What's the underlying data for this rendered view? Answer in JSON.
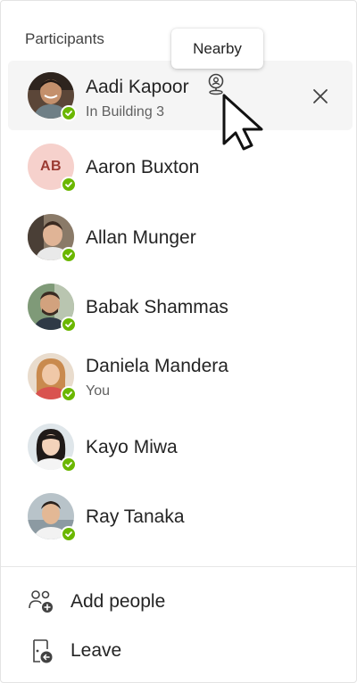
{
  "panel": {
    "section_title": "Participants",
    "tooltip": "Nearby"
  },
  "participants": [
    {
      "name": "Aadi Kapoor",
      "sub": "In Building 3",
      "avatar": "photo",
      "presence": "available",
      "selected": true,
      "nearby_icon": "location-person-icon",
      "remove_icon": "close-icon"
    },
    {
      "name": "Aaron Buxton",
      "sub": "",
      "avatar": "initials",
      "initials": "AB",
      "presence": "available"
    },
    {
      "name": "Allan Munger",
      "sub": "",
      "avatar": "photo",
      "presence": "available"
    },
    {
      "name": "Babak Shammas",
      "sub": "",
      "avatar": "photo",
      "presence": "available"
    },
    {
      "name": "Daniela Mandera",
      "sub": "You",
      "avatar": "photo",
      "presence": "available"
    },
    {
      "name": "Kayo Miwa",
      "sub": "",
      "avatar": "photo",
      "presence": "available"
    },
    {
      "name": "Ray Tanaka",
      "sub": "",
      "avatar": "photo",
      "presence": "available"
    }
  ],
  "actions": {
    "add_people": {
      "label": "Add people",
      "icon": "add-people-icon"
    },
    "leave": {
      "label": "Leave",
      "icon": "leave-icon"
    }
  },
  "colors": {
    "presence_available": "#6bb700",
    "selected_row_bg": "#f5f5f5",
    "initials_bg": "#f6d1cc",
    "initials_fg": "#9b3b32"
  }
}
